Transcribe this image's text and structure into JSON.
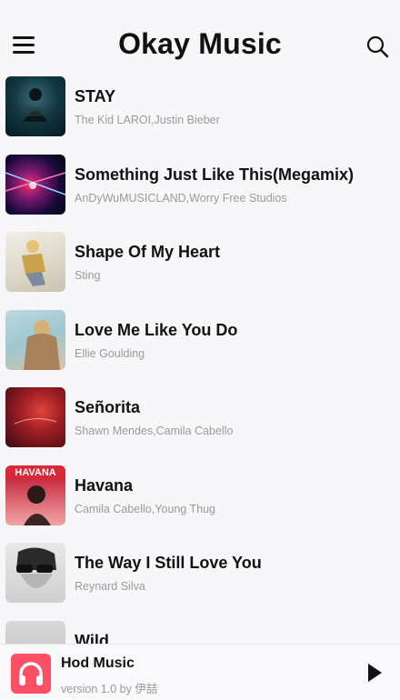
{
  "header": {
    "title": "Okay Music",
    "menu_icon": "hamburger-menu-icon",
    "search_icon": "search-icon"
  },
  "songs": [
    {
      "title": "STAY",
      "artist": "The Kid LAROI,Justin Bieber"
    },
    {
      "title": "Something Just Like This(Megamix)",
      "artist": "AnDyWuMUSICLAND,Worry Free Studios"
    },
    {
      "title": "Shape Of My Heart",
      "artist": "Sting"
    },
    {
      "title": "Love Me Like You Do",
      "artist": "Ellie Goulding"
    },
    {
      "title": "Señorita",
      "artist": "Shawn Mendes,Camila Cabello"
    },
    {
      "title": "Havana",
      "artist": "Camila Cabello,Young Thug"
    },
    {
      "title": "The Way I Still Love You",
      "artist": "Reynard Silva"
    },
    {
      "title": "Wild",
      "artist": ""
    }
  ],
  "player": {
    "app_name": "Hod Music",
    "version": "version 1.0 by 伊喆",
    "logo_icon": "headphones-icon",
    "play_icon": "play-icon"
  },
  "colors": {
    "accent": "#ff4f64",
    "background": "#f7f7f9",
    "secondary_text": "#9a9a9a"
  }
}
